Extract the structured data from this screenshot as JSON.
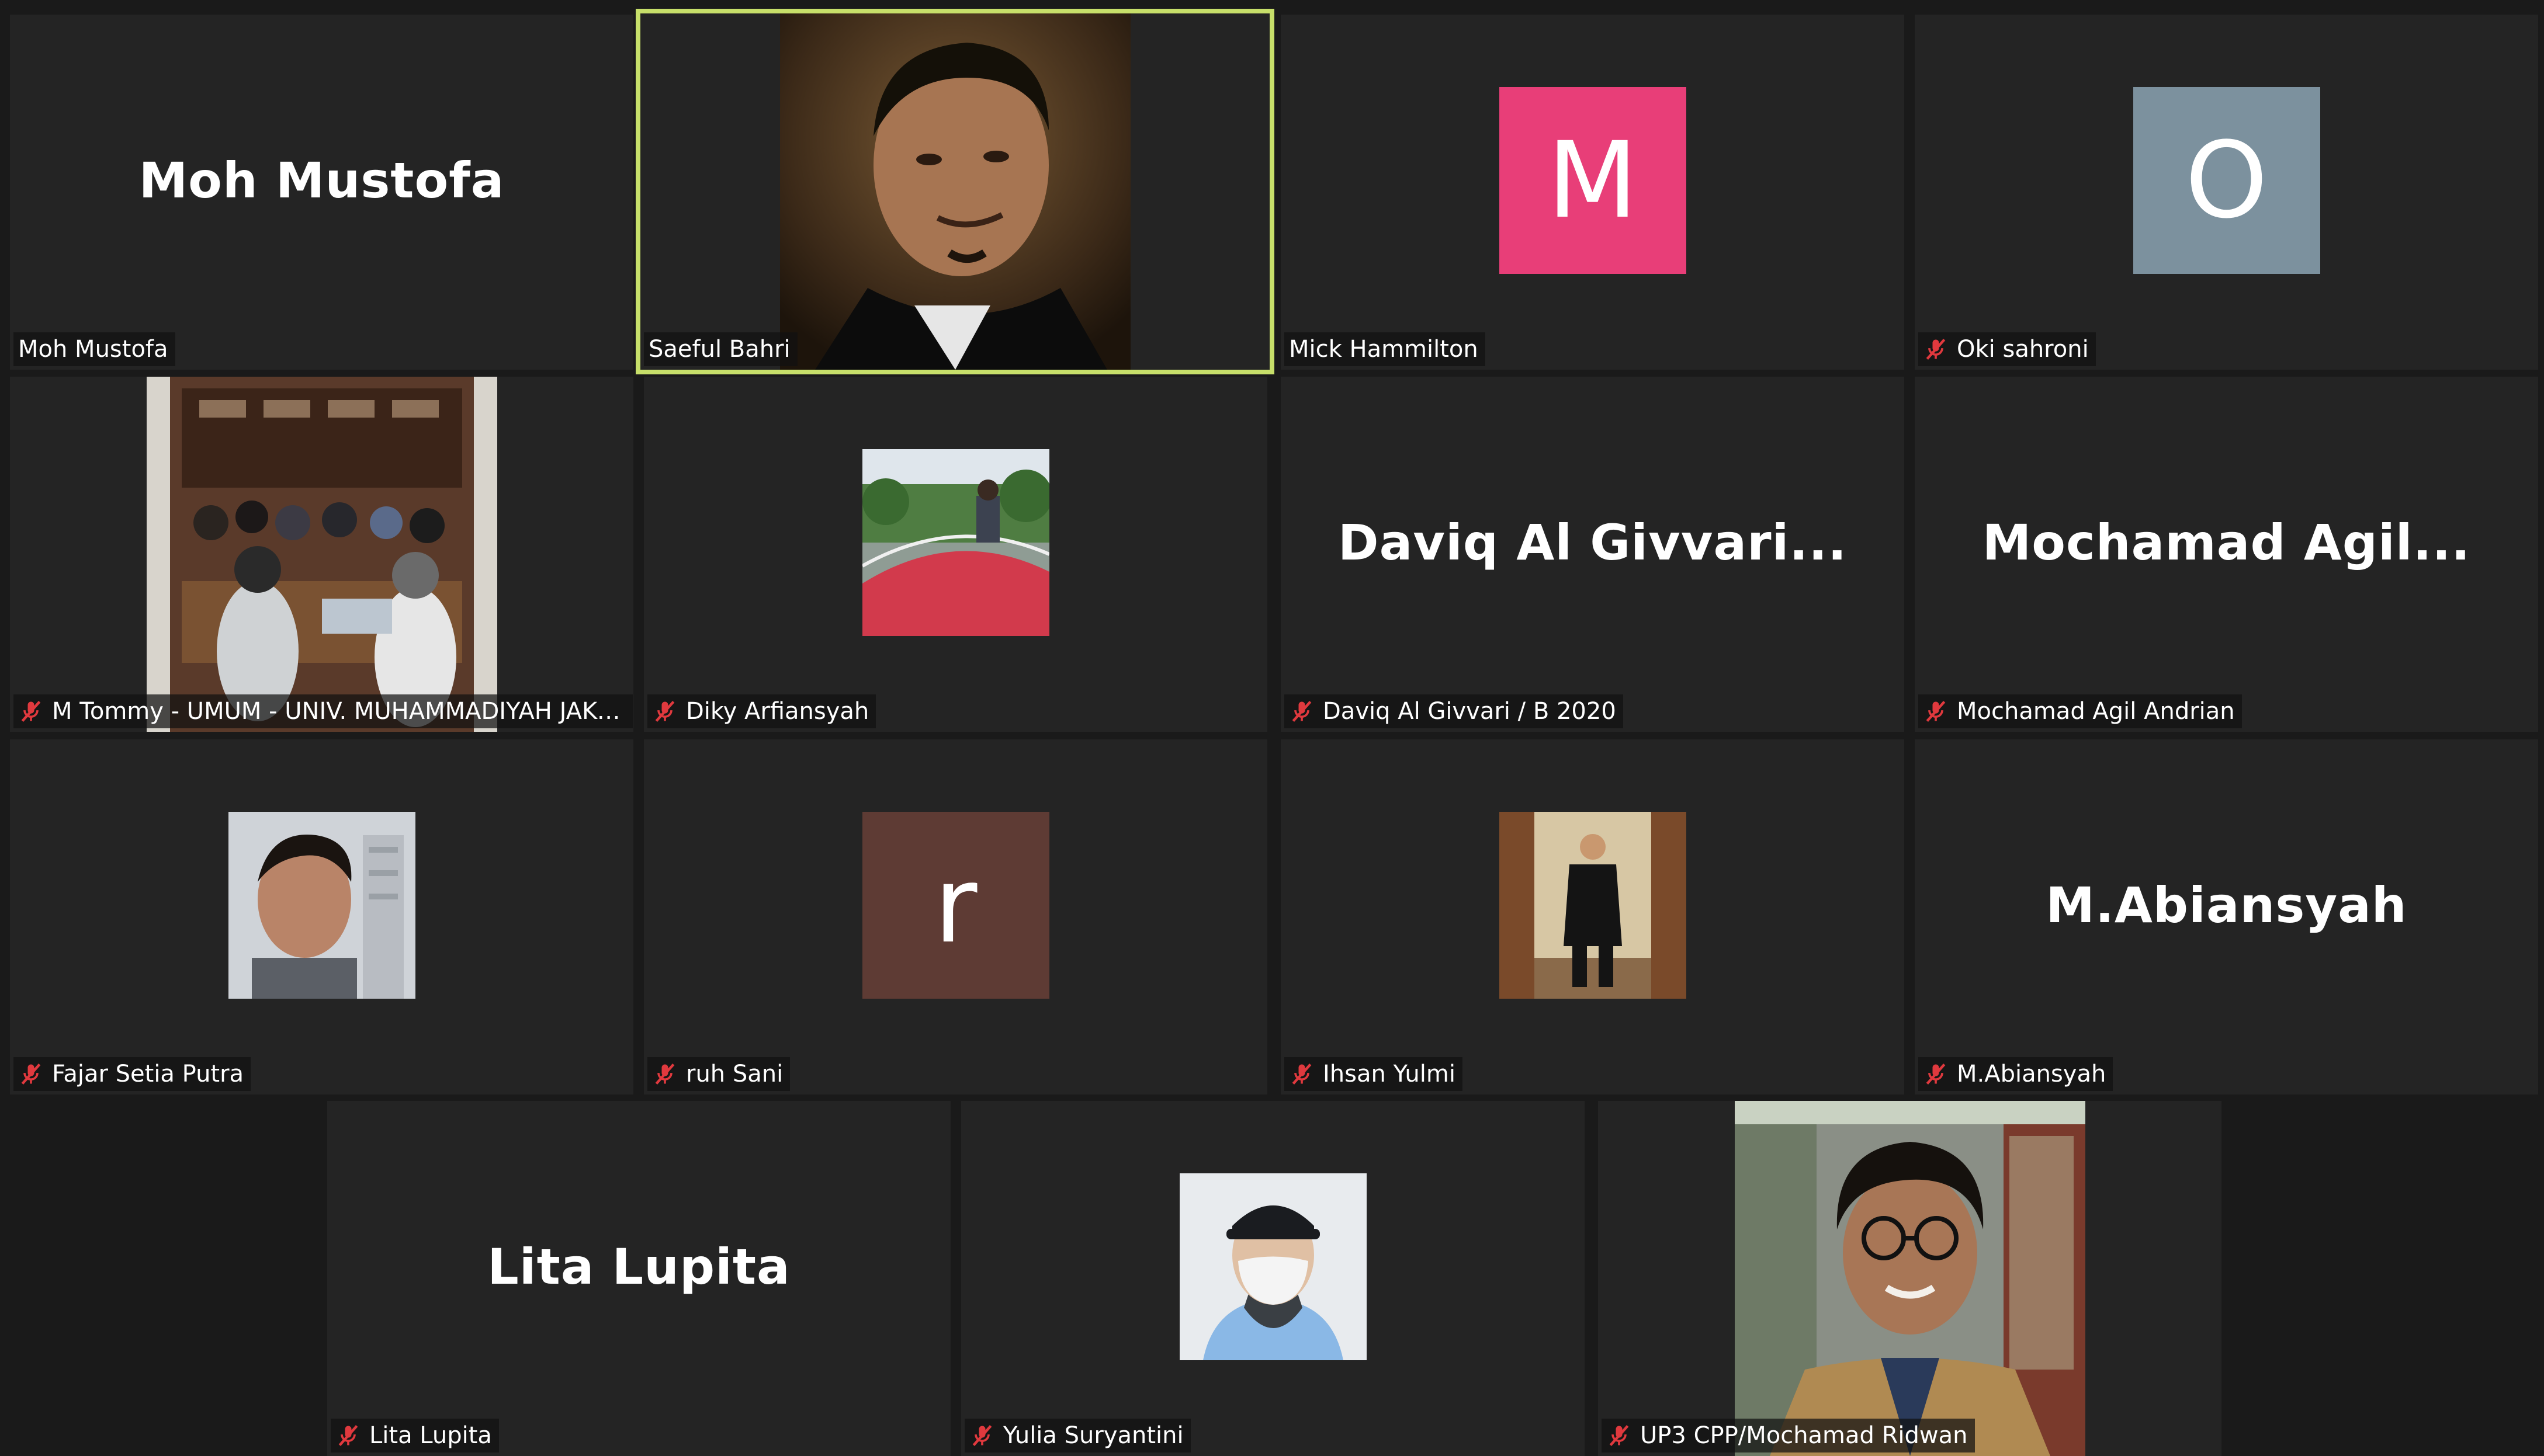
{
  "colors": {
    "background": "#1a1a1a",
    "tile": "#242424",
    "active_speaker_border": "#c7df6a",
    "muted_icon": "#e0393e"
  },
  "participants": [
    {
      "name": "Moh Mustofa",
      "display": "Moh Mustofa",
      "muted": false,
      "active": false
    },
    {
      "name": "Saeful Bahri",
      "muted": false,
      "active": true
    },
    {
      "name": "Mick Hammilton",
      "avatar_letter": "M",
      "avatar_color": "#e83e78",
      "muted": false,
      "active": false
    },
    {
      "name": "Oki sahroni",
      "avatar_letter": "O",
      "avatar_color": "#7c919e",
      "muted": true,
      "active": false
    },
    {
      "name": "M Tommy - UMUM - UNIV. MUHAMMADIYAH JAKA...",
      "muted": true,
      "active": false
    },
    {
      "name": "Diky Arfiansyah",
      "muted": true,
      "active": false
    },
    {
      "name": "Daviq Al Givvari / B 2020",
      "display": "Daviq Al Givvari...",
      "muted": true,
      "active": false
    },
    {
      "name": "Mochamad Agil Andrian",
      "display": "Mochamad Agil...",
      "muted": true,
      "active": false
    },
    {
      "name": "Fajar Setia Putra",
      "muted": true,
      "active": false
    },
    {
      "name": "ruh Sani",
      "avatar_letter": "r",
      "avatar_color": "#5e3b34",
      "muted": true,
      "active": false
    },
    {
      "name": "Ihsan Yulmi",
      "muted": true,
      "active": false
    },
    {
      "name": "M.Abiansyah",
      "display": "M.Abiansyah",
      "muted": true,
      "active": false
    },
    {
      "name": "Lita Lupita",
      "display": "Lita Lupita",
      "muted": true,
      "active": false
    },
    {
      "name": "Yulia Suryantini",
      "muted": true,
      "active": false
    },
    {
      "name": "UP3 CPP/Mochamad Ridwan",
      "muted": true,
      "active": false
    }
  ]
}
